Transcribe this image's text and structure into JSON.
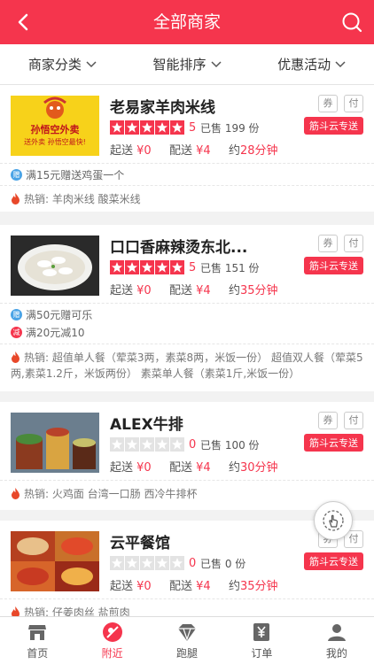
{
  "header": {
    "title": "全部商家",
    "back_icon": "chevron-left-icon",
    "search_icon": "search-icon"
  },
  "filters": [
    {
      "label": "商家分类"
    },
    {
      "label": "智能排序"
    },
    {
      "label": "优惠活动"
    }
  ],
  "shops": [
    {
      "name": "老易家羊肉米线",
      "image_caption": "孙悟空外卖",
      "image_subcaption": "送外卖 孙悟空最快!",
      "rating": 5,
      "score": "5",
      "sold": "已售 199 份",
      "min_order_label": "起送",
      "min_order": "¥0",
      "delivery_fee_label": "配送",
      "delivery_fee": "¥4",
      "time_label": "约",
      "time": "28分钟",
      "badge1": "券",
      "badge2": "付",
      "delivery": "筋斗云专送",
      "promos": [
        {
          "type": "赠",
          "text": "满15元赠送鸡蛋一个"
        }
      ],
      "hot": "热销: 羊肉米线 酸菜米线"
    },
    {
      "name": "口口香麻辣烫东北...",
      "rating": 5,
      "score": "5",
      "sold": "已售 151 份",
      "min_order_label": "起送",
      "min_order": "¥0",
      "delivery_fee_label": "配送",
      "delivery_fee": "¥4",
      "time_label": "约",
      "time": "35分钟",
      "badge1": "券",
      "badge2": "付",
      "delivery": "筋斗云专送",
      "promos": [
        {
          "type": "赠",
          "text": "满50元赠可乐"
        },
        {
          "type": "减",
          "text": "满20元减10"
        }
      ],
      "hot": "热销: 超值单人餐（荤菜3两，素菜8两，米饭一份） 超值双人餐（荤菜5两,素菜1.2斤，米饭两份） 素菜单人餐（素菜1斤,米饭一份）"
    },
    {
      "name": "ALEX牛排",
      "rating": 0,
      "score": "0",
      "sold": "已售 100 份",
      "min_order_label": "起送",
      "min_order": "¥0",
      "delivery_fee_label": "配送",
      "delivery_fee": "¥4",
      "time_label": "约",
      "time": "30分钟",
      "badge1": "券",
      "badge2": "付",
      "delivery": "筋斗云专送",
      "promos": [],
      "hot": "热销: 火鸡面 台湾一口肠 西冷牛排杯"
    },
    {
      "name": "云平餐馆",
      "rating": 0,
      "score": "0",
      "sold": "已售 0 份",
      "min_order_label": "起送",
      "min_order": "¥0",
      "delivery_fee_label": "配送",
      "delivery_fee": "¥4",
      "time_label": "约",
      "time": "35分钟",
      "badge1": "券",
      "badge2": "付",
      "delivery": "筋斗云专送",
      "promos": [],
      "hot": "热销: 仔姜肉丝 盐煎肉"
    }
  ],
  "tabbar": [
    {
      "label": "首页",
      "icon": "shop-icon"
    },
    {
      "label": "附近",
      "icon": "location-icon"
    },
    {
      "label": "跑腿",
      "icon": "diamond-icon"
    },
    {
      "label": "订单",
      "icon": "yen-icon"
    },
    {
      "label": "我的",
      "icon": "user-icon"
    }
  ],
  "colors": {
    "accent": "#f5354d",
    "gift_badge": "#4aa3e6"
  }
}
